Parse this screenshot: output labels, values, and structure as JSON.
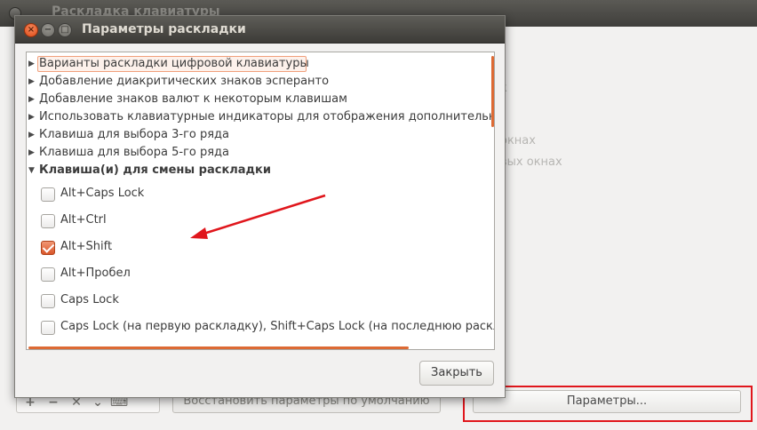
{
  "background_window": {
    "title": "Раскладка клавиатуры",
    "partial_texts": [
      "к",
      "окнах",
      "вых окнах"
    ],
    "toolbar_buttons": [
      "+",
      "−",
      "✕",
      "⌄",
      "⌨"
    ],
    "restore_defaults_label": "Восстановить параметры по умолчанию",
    "params_label": "Параметры..."
  },
  "dialog": {
    "title": "Параметры раскладки",
    "tree_items": [
      {
        "label": "Варианты раскладки цифровой клавиатуры",
        "arrow": "▶"
      },
      {
        "label": "Добавление диакритических знаков эсперанто",
        "arrow": "▶"
      },
      {
        "label": "Добавление знаков валют к некоторым клавишам",
        "arrow": "▶"
      },
      {
        "label": "Использовать клавиатурные индикаторы для отображения дополнительн",
        "arrow": "▶"
      },
      {
        "label": "Клавиша для выбора 3-го ряда",
        "arrow": "▶"
      },
      {
        "label": "Клавиша для выбора 5-го ряда",
        "arrow": "▶"
      },
      {
        "label": "Клавиша(и) для смены раскладки",
        "arrow": "▼"
      }
    ],
    "options": [
      {
        "label": "Alt+Caps Lock",
        "checked": false
      },
      {
        "label": "Alt+Ctrl",
        "checked": false
      },
      {
        "label": "Alt+Shift",
        "checked": true
      },
      {
        "label": "Alt+Пробел",
        "checked": false
      },
      {
        "label": "Caps Lock",
        "checked": false
      },
      {
        "label": "Caps Lock (на первую раскладку), Shift+Caps Lock (на последнюю раскл",
        "checked": false
      }
    ],
    "close_label": "Закрыть"
  },
  "colors": {
    "accent": "#dd6a34",
    "annotation_red": "#e0161c"
  }
}
